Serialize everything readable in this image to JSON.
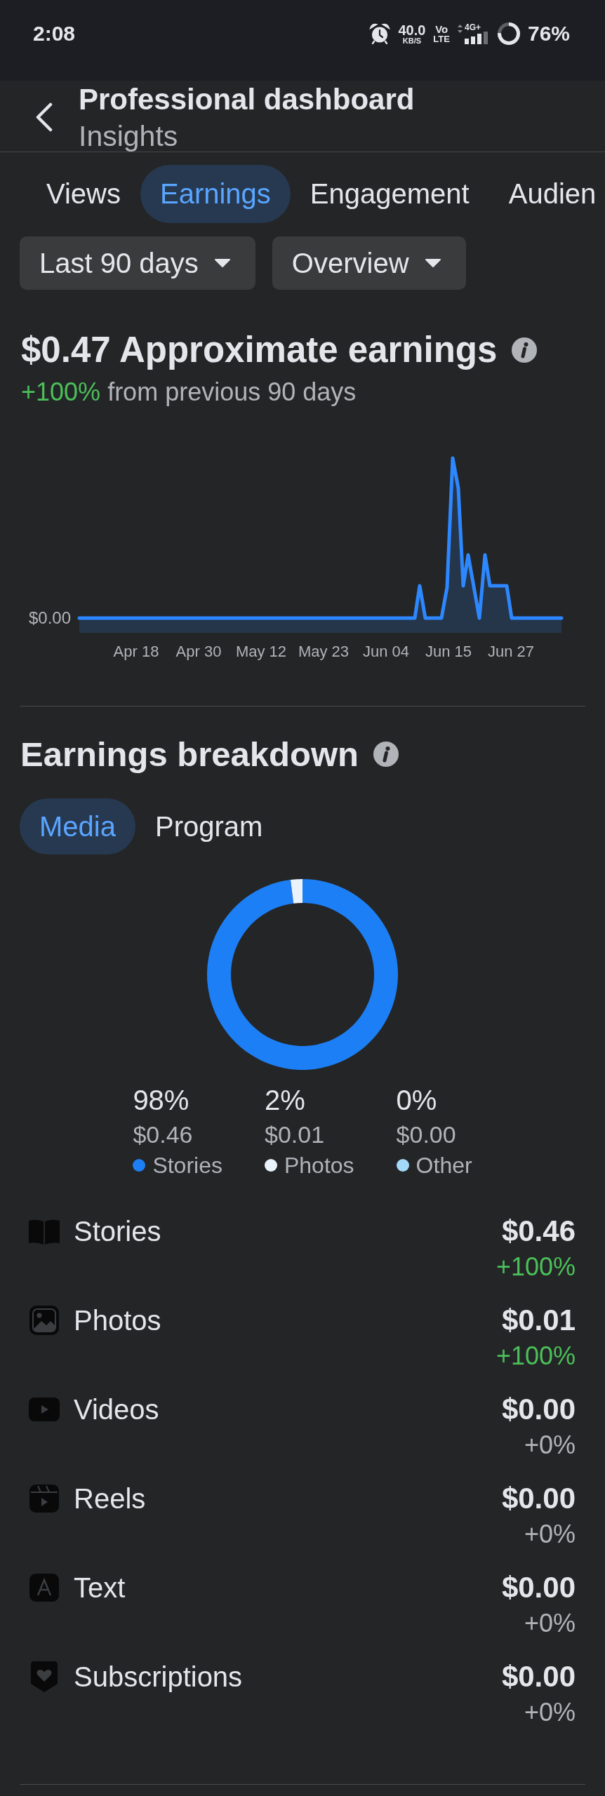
{
  "status_bar": {
    "time": "2:08",
    "network_speed": "40.0",
    "network_speed_unit": "KB/S",
    "volte": [
      "Vo",
      "LTE"
    ],
    "network_type": "4G+",
    "battery": "76%"
  },
  "header": {
    "title": "Professional dashboard",
    "subtitle": "Insights"
  },
  "tabs": [
    {
      "label": "Views",
      "selected": false
    },
    {
      "label": "Earnings",
      "selected": true
    },
    {
      "label": "Engagement",
      "selected": false
    },
    {
      "label": "Audien",
      "selected": false
    }
  ],
  "filters": [
    {
      "label": "Last 90 days"
    },
    {
      "label": "Overview"
    }
  ],
  "earnings": {
    "headline": "$0.47 Approximate earnings",
    "change": "+100%",
    "comparison": "from previous 90 days",
    "chart": {
      "y_label": "$0.00",
      "x_labels": [
        "Apr 18",
        "Apr 30",
        "May 12",
        "May 23",
        "Jun 04",
        "Jun 15",
        "Jun 27"
      ]
    }
  },
  "breakdown": {
    "title": "Earnings breakdown",
    "tabs": [
      {
        "label": "Media",
        "selected": true
      },
      {
        "label": "Program",
        "selected": false
      }
    ],
    "chart_data": {
      "type": "donut",
      "categories": [
        "Stories",
        "Photos",
        "Other"
      ],
      "values": [
        98,
        2,
        0
      ]
    },
    "legend": [
      {
        "percent": "98%",
        "amount": "$0.46",
        "color": "#1d7ff5"
      },
      {
        "percent": "2%",
        "amount": "$0.01",
        "color": "#eaf2fb"
      },
      {
        "percent": "0%",
        "amount": "$0.00",
        "color": "#a3d8f8"
      }
    ],
    "items": [
      {
        "kind": "stories",
        "label": "Stories",
        "amount": "$0.46",
        "change": "+100%",
        "positive": true
      },
      {
        "kind": "photos",
        "label": "Photos",
        "amount": "$0.01",
        "change": "+100%",
        "positive": true
      },
      {
        "kind": "videos",
        "label": "Videos",
        "amount": "$0.00",
        "change": "+0%",
        "positive": false
      },
      {
        "kind": "reels",
        "label": "Reels",
        "amount": "$0.00",
        "change": "+0%",
        "positive": false
      },
      {
        "kind": "text",
        "label": "Text",
        "amount": "$0.00",
        "change": "+0%",
        "positive": false
      },
      {
        "kind": "subscriptions",
        "label": "Subscriptions",
        "amount": "$0.00",
        "change": "+0%",
        "positive": false
      }
    ]
  }
}
